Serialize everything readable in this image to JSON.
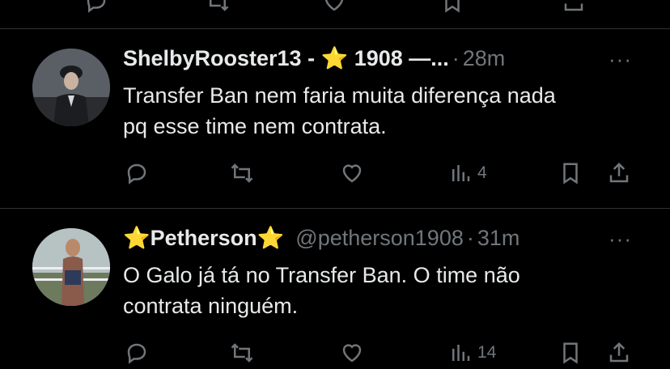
{
  "tweets": [
    {
      "display_name": "ShelbyRooster13 - ⭐ 1908 —...",
      "handle": "",
      "separator": "·",
      "time": "28m",
      "more": "···",
      "text_line1": "Transfer Ban nem faria muita diferença nada",
      "text_line2": "pq esse time nem contrata.",
      "views": "4"
    },
    {
      "display_name_star_left": "⭐",
      "display_name": "Petherson",
      "display_name_star_right": "⭐",
      "handle": "@petherson1908",
      "separator": "·",
      "time": "31m",
      "more": "···",
      "text_line1": "O Galo já tá no Transfer Ban. O time não",
      "text_line2": "contrata ninguém.",
      "views": "14"
    }
  ],
  "icons": [
    "reply-icon",
    "retweet-icon",
    "like-icon",
    "views-icon",
    "bookmark-icon",
    "share-icon",
    "more-icon"
  ],
  "colors": {
    "background": "#000000",
    "text": "#e7e9ea",
    "muted": "#71767b",
    "divider": "#2f3336"
  }
}
